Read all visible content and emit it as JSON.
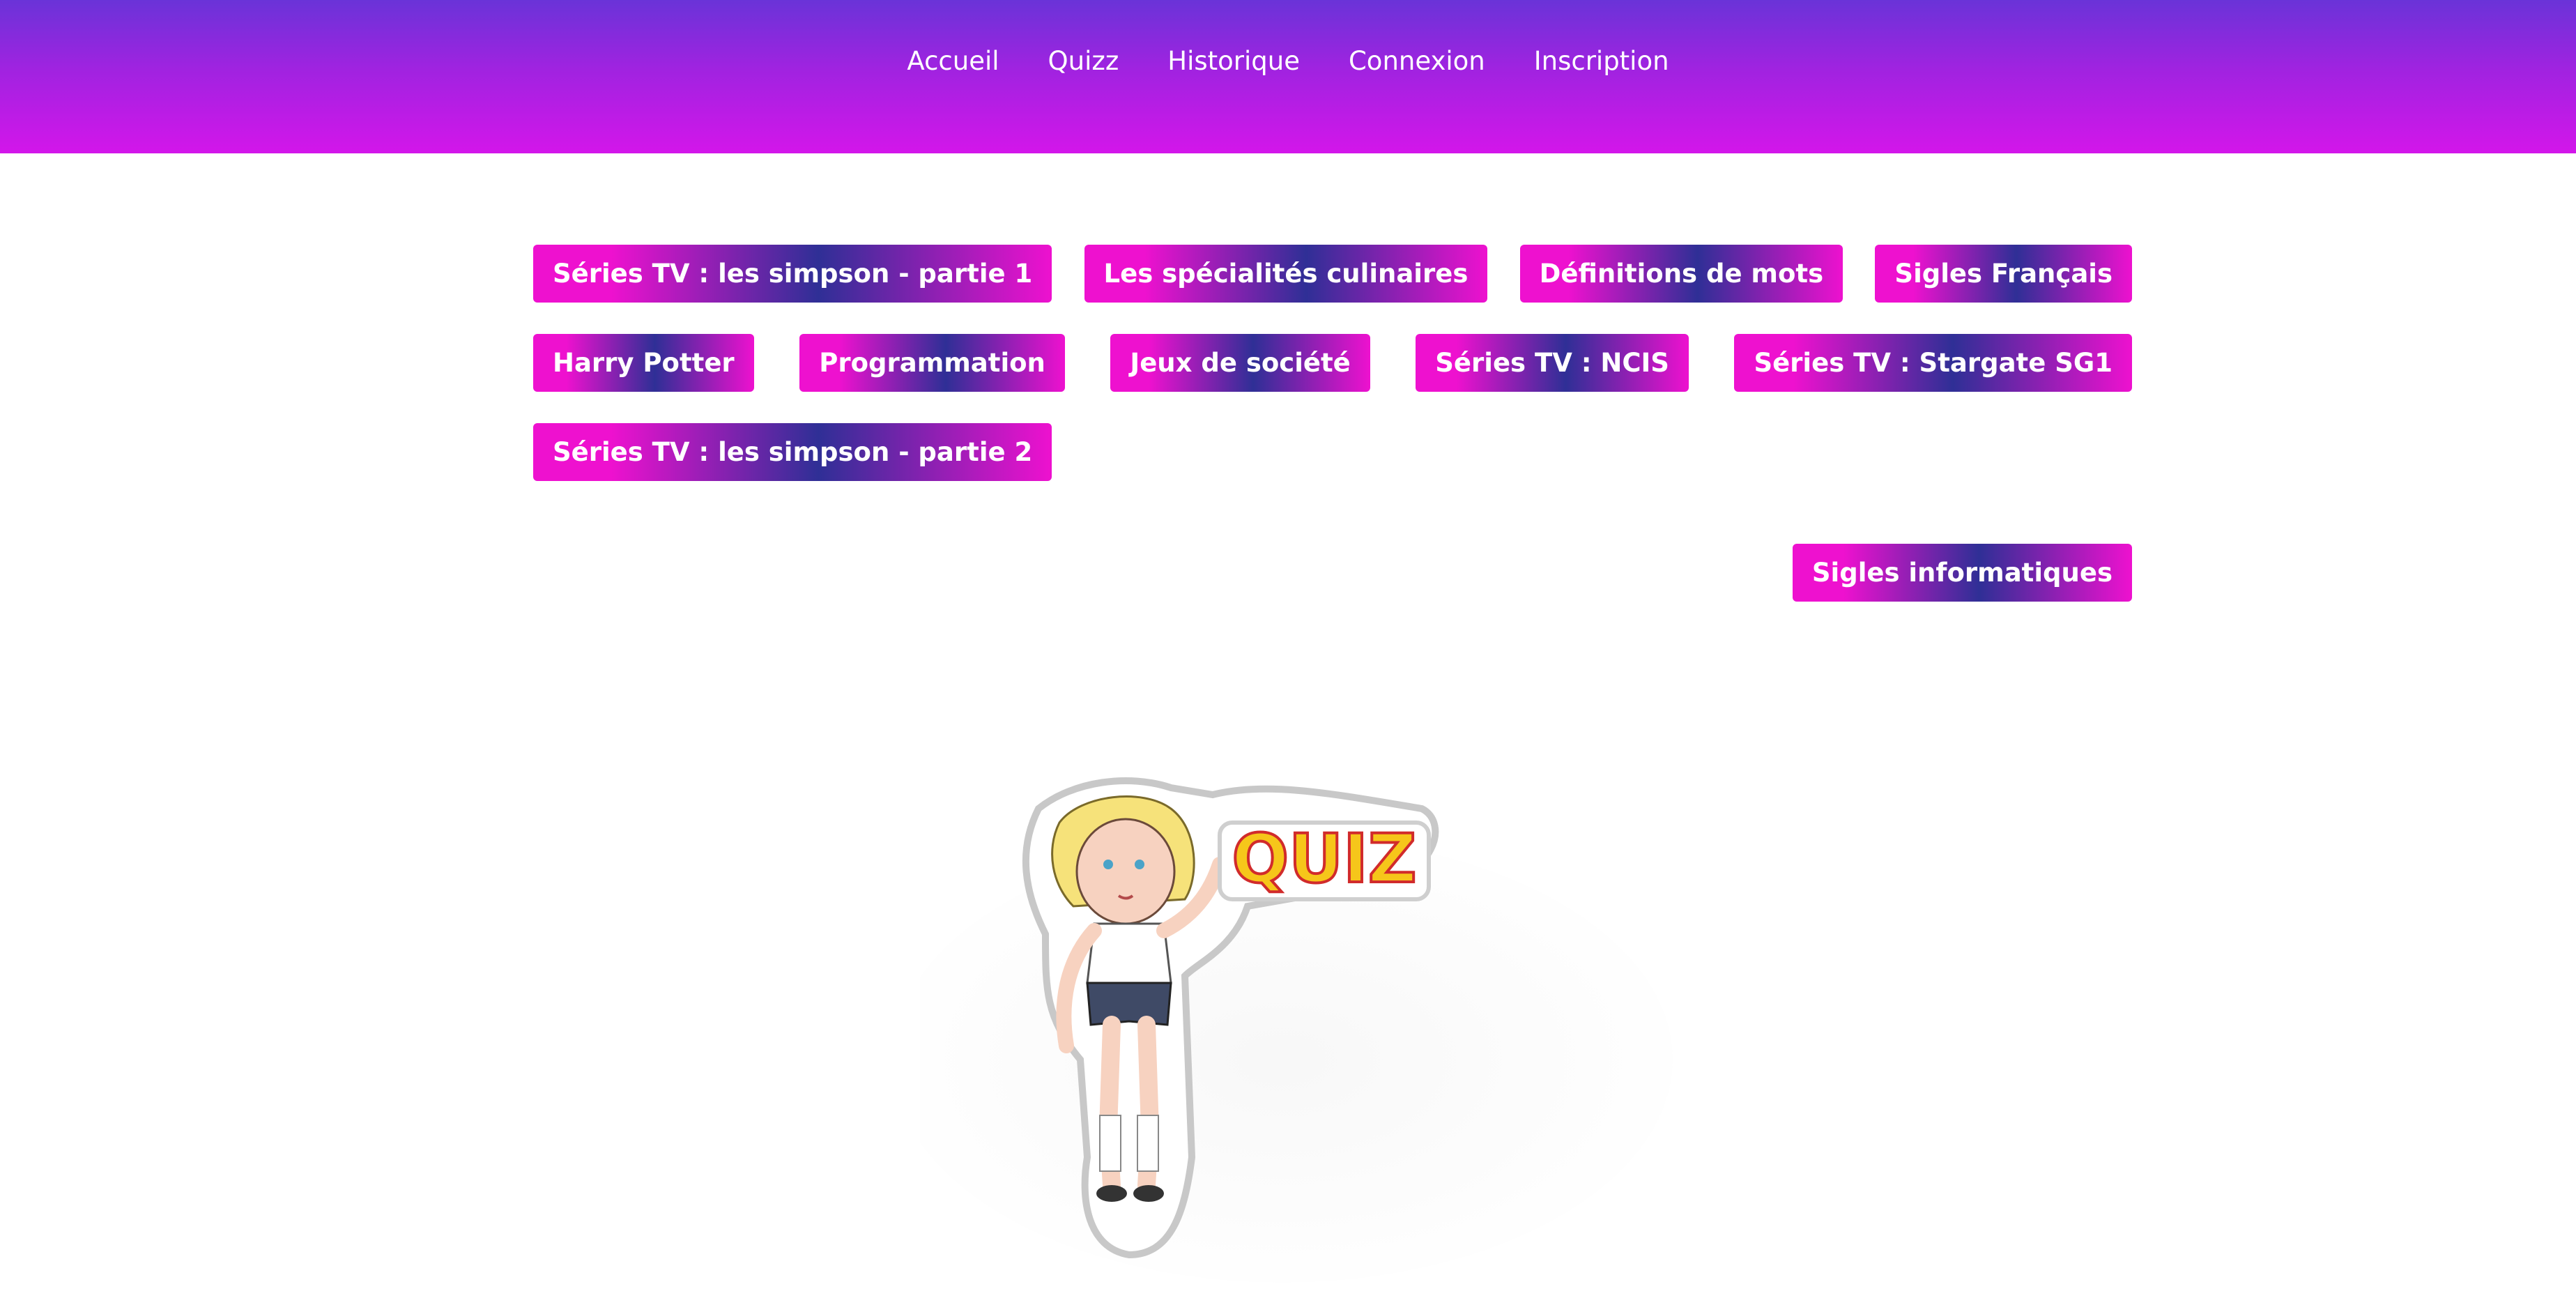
{
  "nav": {
    "items": [
      {
        "label": "Accueil"
      },
      {
        "label": "Quizz"
      },
      {
        "label": "Historique"
      },
      {
        "label": "Connexion"
      },
      {
        "label": "Inscription"
      }
    ]
  },
  "quizzes": [
    {
      "label": "Séries TV : les simpson - partie 1"
    },
    {
      "label": "Les spécialités culinaires"
    },
    {
      "label": "Définitions de mots"
    },
    {
      "label": "Sigles Français"
    },
    {
      "label": "Harry Potter"
    },
    {
      "label": "Programmation"
    },
    {
      "label": "Jeux de société"
    },
    {
      "label": "Séries TV : NCIS"
    },
    {
      "label": "Séries TV : Stargate SG1"
    },
    {
      "label": "Séries TV : les simpson - partie 2"
    },
    {
      "label": "Sigles informatiques"
    }
  ],
  "illustration": {
    "logo_text": "QUIZ"
  },
  "colors": {
    "header_top": "#6a33d8",
    "header_bottom": "#d316ea",
    "button_pink": "#ee11cf",
    "button_blue": "#2f2f96"
  }
}
